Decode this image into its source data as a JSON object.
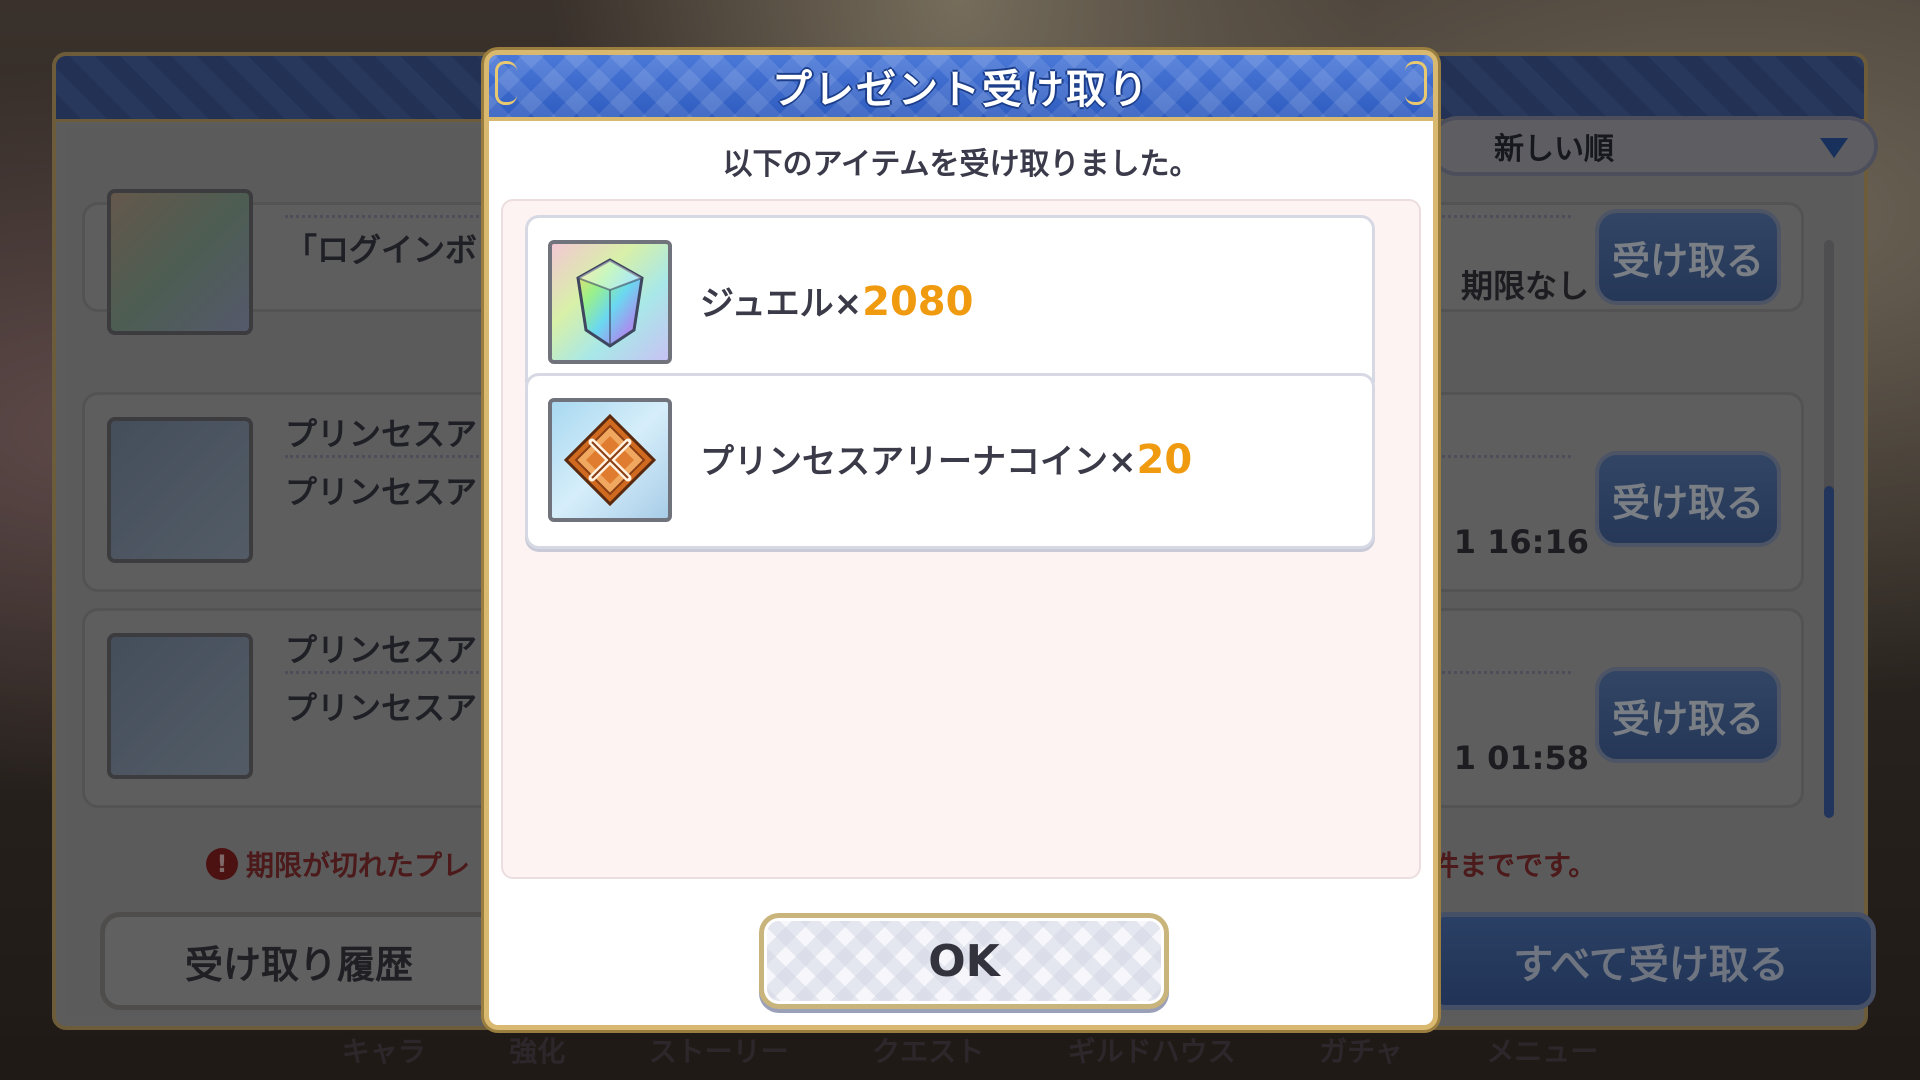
{
  "background": {
    "sort_label": "新しい順",
    "rows": [
      {
        "text1": "「ログインボ",
        "meta": "期限なし",
        "button": "受け取る"
      },
      {
        "text1": "プリンセスア",
        "text2": "プリンセスア",
        "meta": "1 16:16",
        "button": "受け取る"
      },
      {
        "text1": "プリンセスア",
        "text2": "プリンセスア",
        "meta": "1 01:58",
        "button": "受け取る"
      }
    ],
    "notice_left": "期限が切れたプレ",
    "notice_right": "件までです。",
    "history_button": "受け取り履歴",
    "receive_all_button": "すべて受け取る",
    "nav": [
      "キャラ",
      "強化",
      "ストーリー",
      "クエスト",
      "ギルドハウス",
      "ガチャ",
      "メニュー"
    ]
  },
  "modal": {
    "title": "プレゼント受け取り",
    "subtitle": "以下のアイテムを受け取りました。",
    "items": [
      {
        "name": "ジュエル×",
        "quantity": "2080",
        "icon": "jewel-icon"
      },
      {
        "name": "プリンセスアリーナコイン×",
        "quantity": "20",
        "icon": "arena-coin-icon"
      }
    ],
    "ok_label": "OK"
  },
  "colors": {
    "header_blue": "#2f5cc0",
    "gold_border": "#d9b870",
    "quantity_orange": "#f09a10"
  }
}
